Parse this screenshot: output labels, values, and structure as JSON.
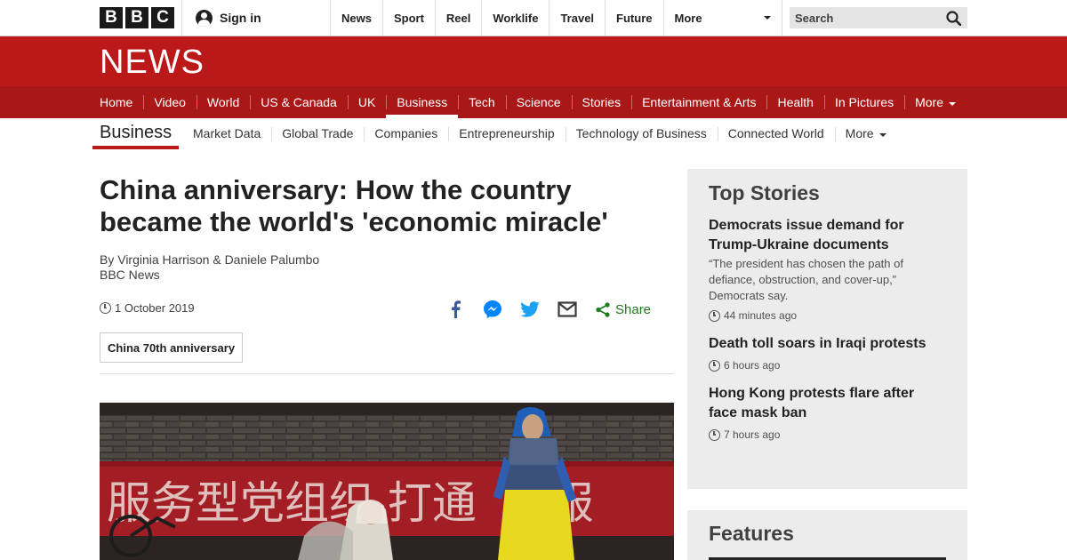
{
  "topbar": {
    "logo": [
      "B",
      "B",
      "C"
    ],
    "signin_label": "Sign in",
    "nav": [
      "News",
      "Sport",
      "Reel",
      "Worklife",
      "Travel",
      "Future"
    ],
    "more_label": "More",
    "search_placeholder": "Search"
  },
  "news": {
    "title": "NEWS",
    "nav": [
      {
        "label": "Home"
      },
      {
        "label": "Video"
      },
      {
        "label": "World"
      },
      {
        "label": "US & Canada"
      },
      {
        "label": "UK"
      },
      {
        "label": "Business",
        "active": true
      },
      {
        "label": "Tech"
      },
      {
        "label": "Science"
      },
      {
        "label": "Stories"
      },
      {
        "label": "Entertainment & Arts"
      },
      {
        "label": "Health"
      },
      {
        "label": "In Pictures"
      }
    ],
    "more_label": "More"
  },
  "section": {
    "title": "Business",
    "items": [
      "Market Data",
      "Global Trade",
      "Companies",
      "Entrepreneurship",
      "Technology of Business",
      "Connected World"
    ],
    "more_label": "More"
  },
  "article": {
    "headline_line1": "China anniversary: How the country",
    "headline_line2": "became the world's 'economic miracle'",
    "byline": "By Virginia Harrison & Daniele Palumbo",
    "source": "BBC News",
    "date": "1 October 2019",
    "share_label": "Share",
    "tag": "China 70th anniversary",
    "photo_banner_text": "服务型党组织 打通 ‘系服"
  },
  "top_stories": {
    "title": "Top Stories",
    "items": [
      {
        "headline": "Democrats issue demand for Trump-Ukraine documents",
        "summary": "“The president has chosen the path of defiance, obstruction, and cover-up,” Democrats say.",
        "time": "44 minutes ago"
      },
      {
        "headline": "Death toll soars in Iraqi protests",
        "summary": "",
        "time": "6 hours ago"
      },
      {
        "headline": "Hong Kong protests flare after face mask ban",
        "summary": "",
        "time": "7 hours ago"
      }
    ]
  },
  "features": {
    "title": "Features"
  },
  "colors": {
    "bbc_red": "#bb1919",
    "nav_red": "#a91717",
    "share_green": "#1e7a1e",
    "facebook_blue": "#3b5998",
    "messenger_blue": "#0084ff",
    "twitter_blue": "#1da1f2"
  }
}
